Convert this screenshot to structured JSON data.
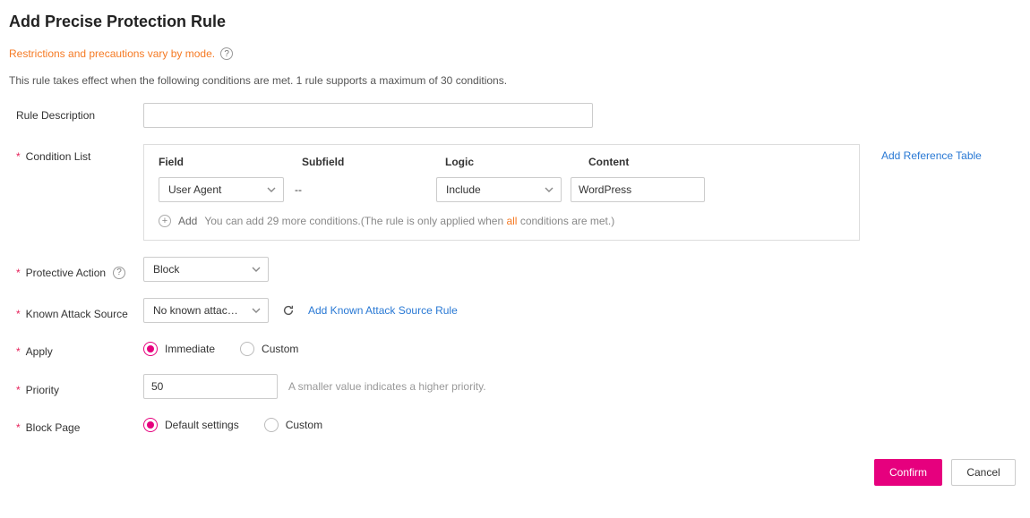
{
  "title": "Add Precise Protection Rule",
  "restrictions_text": "Restrictions and precautions vary by mode.",
  "effect_note": "This rule takes effect when the following conditions are met. 1 rule supports a maximum of 30 conditions.",
  "labels": {
    "rule_description": "Rule Description",
    "condition_list": "Condition List",
    "protective_action": "Protective Action",
    "known_attack_source": "Known Attack Source",
    "apply": "Apply",
    "priority": "Priority",
    "block_page": "Block Page"
  },
  "condition": {
    "headers": {
      "field": "Field",
      "subfield": "Subfield",
      "logic": "Logic",
      "content": "Content"
    },
    "row": {
      "field": "User Agent",
      "subfield": "--",
      "logic": "Include",
      "content": "WordPress"
    },
    "add_label": "Add",
    "add_hint_before": "You can add 29 more conditions.(The rule is only applied when ",
    "add_hint_highlight": "all",
    "add_hint_after": " conditions are met.)",
    "ref_link": "Add Reference Table"
  },
  "protective_action": {
    "value": "Block"
  },
  "known_attack_source": {
    "value": "No known attack…",
    "link": "Add Known Attack Source Rule"
  },
  "apply": {
    "opt_immediate": "Immediate",
    "opt_custom": "Custom"
  },
  "priority": {
    "value": "50",
    "hint": "A smaller value indicates a higher priority."
  },
  "block_page": {
    "opt_default": "Default settings",
    "opt_custom": "Custom"
  },
  "buttons": {
    "confirm": "Confirm",
    "cancel": "Cancel"
  }
}
